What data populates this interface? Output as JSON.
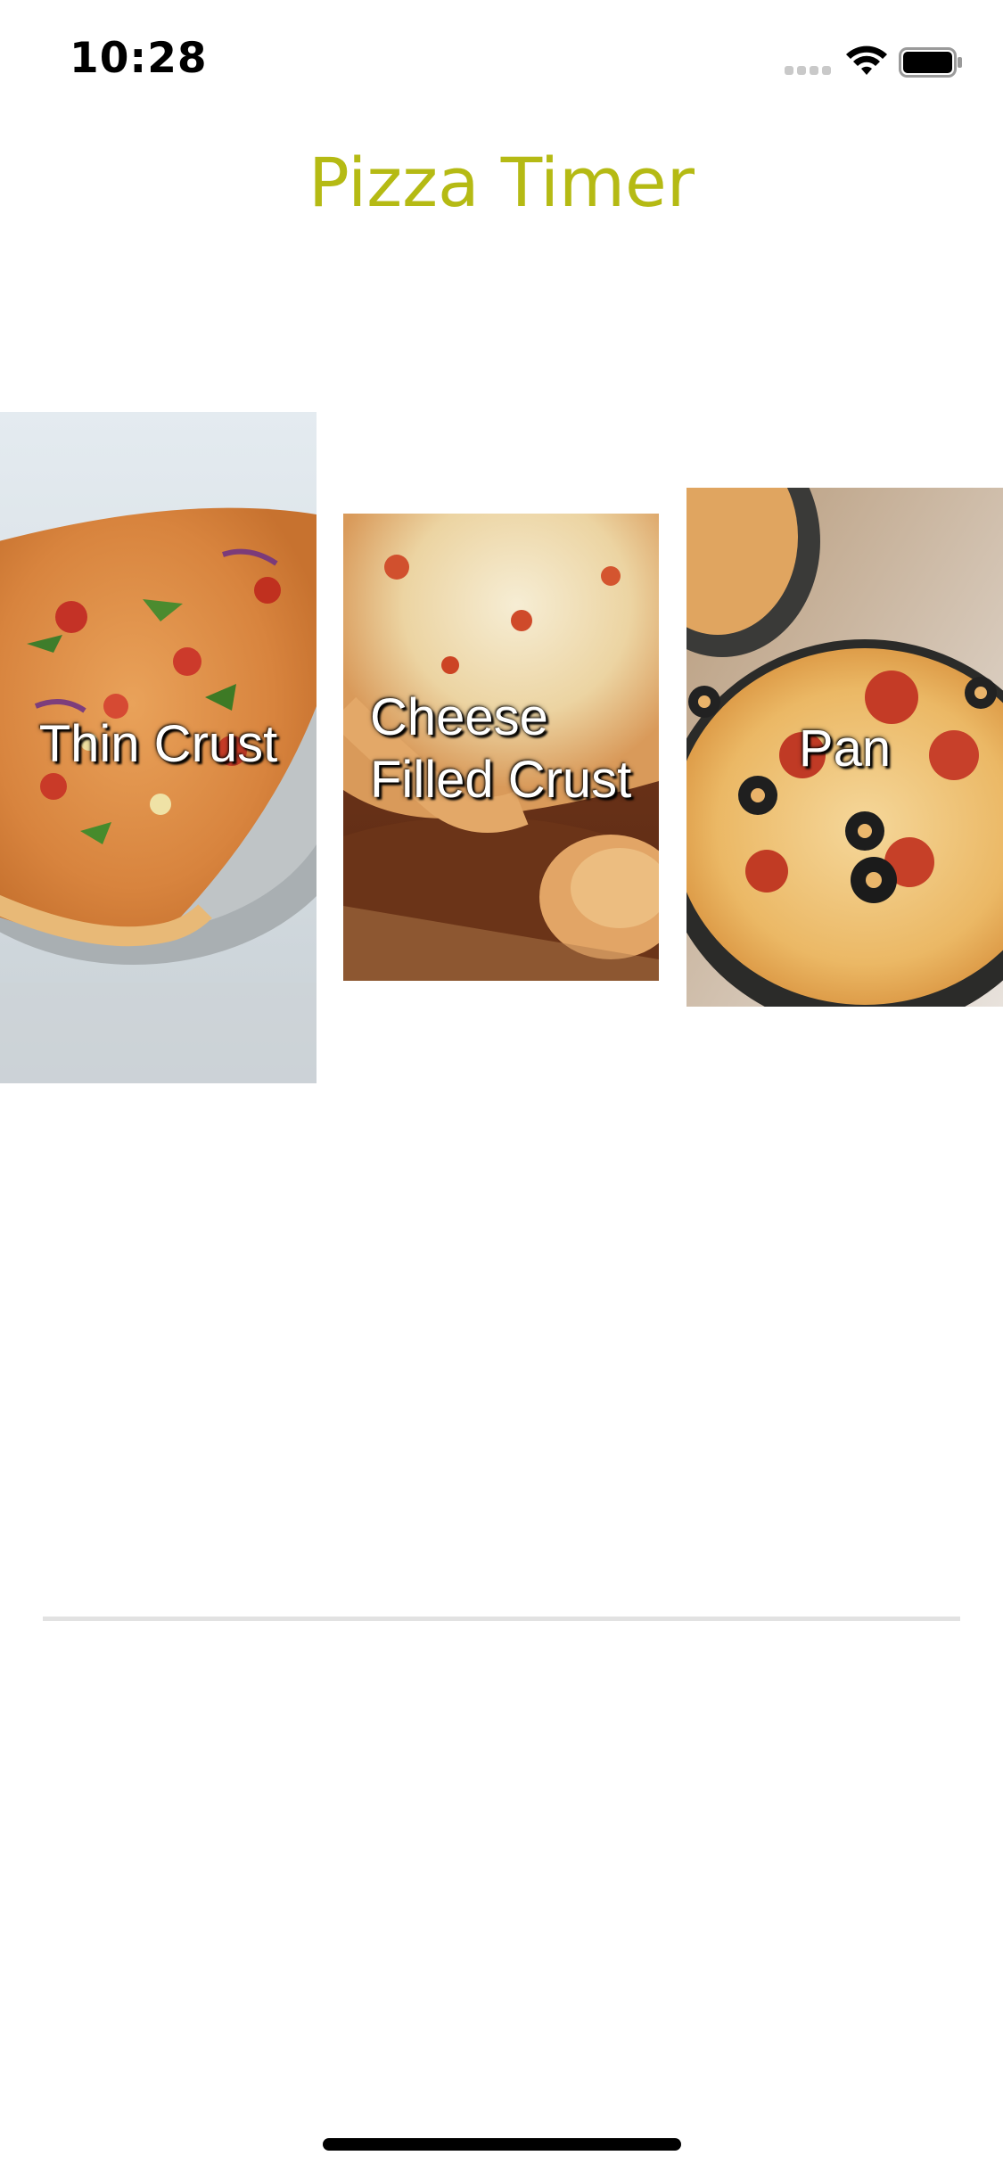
{
  "status_bar": {
    "time": "10:28",
    "icons": [
      "signal-icon",
      "wifi-icon",
      "battery-icon"
    ]
  },
  "title": "Pizza Timer",
  "title_color": "#b5ba14",
  "crust_options": [
    {
      "label": "Thin Crust"
    },
    {
      "label": "Cheese Filled Crust",
      "line1": "Cheese",
      "line2": "Filled Crust"
    },
    {
      "label": "Pan"
    }
  ]
}
